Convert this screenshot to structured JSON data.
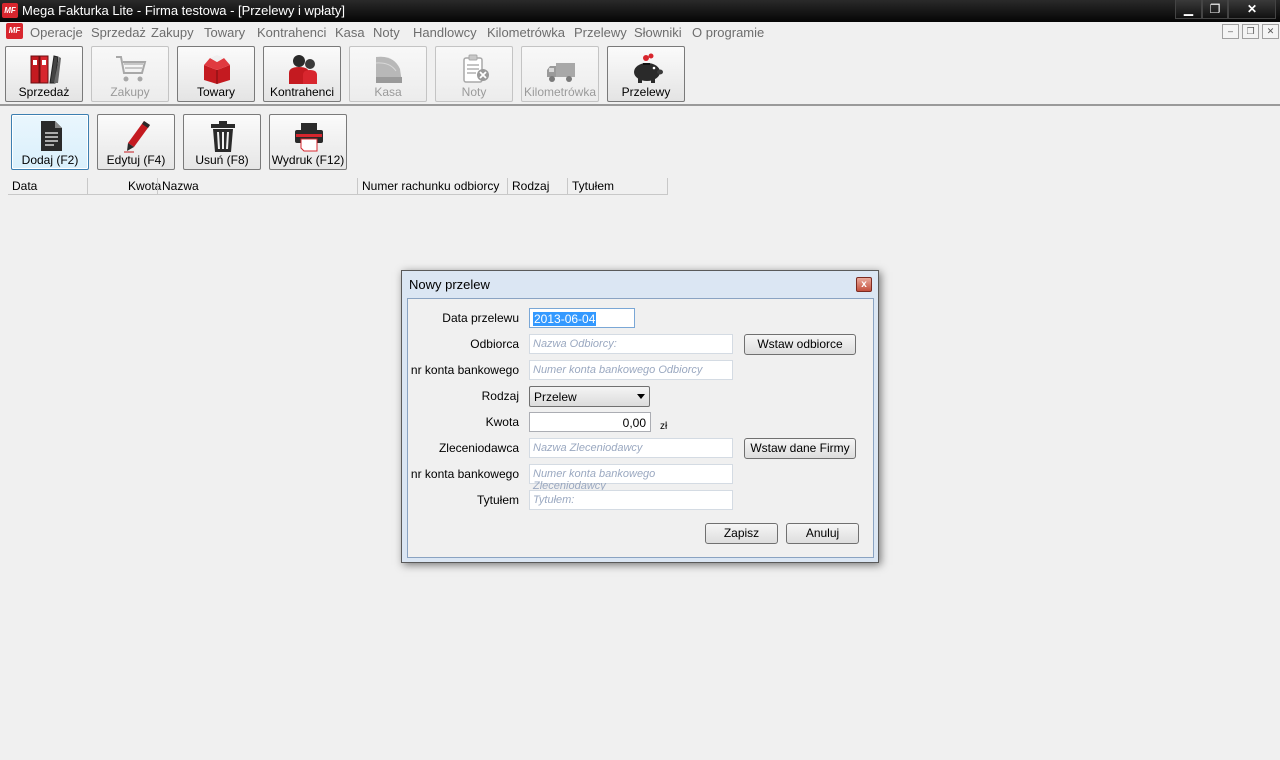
{
  "window": {
    "title": "Mega Fakturka Lite - Firma testowa - [Przelewy i wpłaty]",
    "app_icon_text": "MF",
    "minimize": "▁",
    "maximize": "❐",
    "close": "✕"
  },
  "menu": {
    "items": [
      "Operacje",
      "Sprzedaż",
      "Zakupy",
      "Towary",
      "Kontrahenci",
      "Kasa",
      "Noty",
      "Handlowcy",
      "Kilometrówka",
      "Przelewy",
      "Słowniki",
      "O programie"
    ],
    "mdi_min": "–",
    "mdi_restore": "❐",
    "mdi_close": "✕"
  },
  "toolbar": {
    "buttons": [
      {
        "label": "Sprzedaż",
        "icon": "binders-icon",
        "enabled": true
      },
      {
        "label": "Zakupy",
        "icon": "cart-icon",
        "enabled": false
      },
      {
        "label": "Towary",
        "icon": "box-icon",
        "enabled": true
      },
      {
        "label": "Kontrahenci",
        "icon": "people-icon",
        "enabled": true
      },
      {
        "label": "Kasa",
        "icon": "cash-icon",
        "enabled": false
      },
      {
        "label": "Noty",
        "icon": "note-icon",
        "enabled": false
      },
      {
        "label": "Kilometrówka",
        "icon": "truck-icon",
        "enabled": false
      },
      {
        "label": "Przelewy",
        "icon": "piggy-bank-icon",
        "enabled": true
      }
    ]
  },
  "actions": {
    "add": "Dodaj (F2)",
    "edit": "Edytuj (F4)",
    "delete": "Usuń (F8)",
    "print": "Wydruk (F12)"
  },
  "grid": {
    "columns": [
      "Data",
      "Kwota",
      "Nazwa",
      "Numer rachunku odbiorcy",
      "Rodzaj",
      "Tytułem"
    ]
  },
  "dialog": {
    "title": "Nowy przelew",
    "close": "x",
    "fields": {
      "date_label": "Data przelewu",
      "date_value": "2013-06-04",
      "recipient_label": "Odbiorca",
      "recipient_placeholder": "Nazwa Odbiorcy:",
      "recipient_account_label": "nr konta bankowego",
      "recipient_account_placeholder": "Numer konta bankowego Odbiorcy",
      "type_label": "Rodzaj",
      "type_value": "Przelew",
      "amount_label": "Kwota",
      "amount_value": "0,00",
      "currency": "zł",
      "payer_label": "Zleceniodawca",
      "payer_placeholder": "Nazwa Zleceniodawcy",
      "payer_account_label": "nr konta bankowego",
      "payer_account_placeholder": "Numer konta bankowego Zleceniodawcy",
      "title_label": "Tytułem",
      "title_placeholder": "Tytułem:"
    },
    "buttons": {
      "insert_recipient": "Wstaw odbiorce",
      "insert_company": "Wstaw dane Firmy",
      "save": "Zapisz",
      "cancel": "Anuluj"
    }
  }
}
